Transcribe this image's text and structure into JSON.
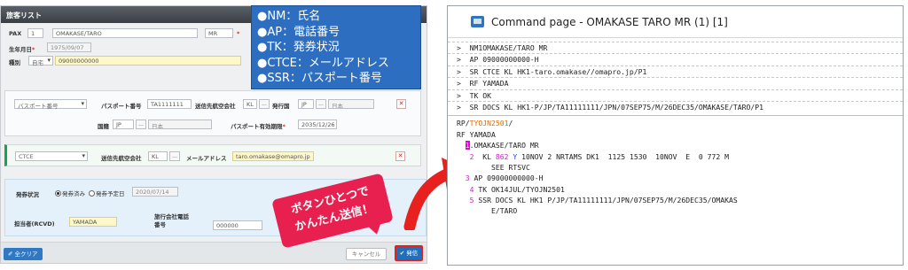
{
  "form": {
    "title": "旅客リスト",
    "pax_label": "PAX",
    "pax_number": "1",
    "pax_name": "OMAKASE/TARO",
    "pax_title": "MR",
    "dob_label": "生年月日",
    "dob_value": "1975/09/07",
    "type_label": "種別",
    "type_value": "自宅",
    "phone_value": "09000000000",
    "passport": {
      "doc_type": "パスポート番号",
      "number_label": "パスポート番号",
      "number_value": "TA1111111",
      "airline_label": "送信先航空会社",
      "airline_value": "KL",
      "issuer_label": "発行国",
      "issuer_code": "JP",
      "issuer_name": "日本",
      "nationality_label": "国籍",
      "nationality_code": "JP",
      "nationality_name": "日本",
      "expiry_label": "パスポート有効期限",
      "expiry_value": "2035/12/26"
    },
    "email": {
      "type": "CTCE",
      "airline_label": "送信先航空会社",
      "airline_value": "KL",
      "address_label": "メールアドレス",
      "address_value": "taro.omakase@omapro.jp"
    },
    "ticketing": {
      "status_label": "発券状況",
      "option_issued": "発券済み",
      "option_planned": "発券予定日",
      "date_value": "2020/07/14",
      "rep_label": "担当者(RCVD)",
      "rep_value": "YAMADA",
      "agency_phone_label": "旅行会社電話番号",
      "agency_phone_value": "000000"
    },
    "buttons": {
      "clear_all": "全クリア",
      "cancel": "キャンセル",
      "send": "発信",
      "dots": "..."
    }
  },
  "legend": {
    "items": [
      "●NM：氏名",
      "●AP：電話番号",
      "●TK：発券状況",
      "●CTCE：メールアドレス",
      "●SSR：パスポート番号"
    ]
  },
  "callout": {
    "line1": "ボタンひとつで",
    "line2": "かんたん送信！"
  },
  "command_page": {
    "title": "Command page - OMAKASE TARO MR (1) [1]",
    "input_lines": [
      ">  NM1OMAKASE/TARO MR",
      ">  AP 09000000000-H",
      ">  SR CTCE KL HK1-taro.omakase//omapro.jp/P1",
      ">  RF YAMADA",
      ">  TK OK",
      ">  SR DOCS KL HK1-P/JP/TA11111111/JPN/07SEP75/M/26DEC35/OMAKASE/TARO/P1"
    ],
    "rp_prefix": "RP/",
    "rp_code": "TYOJN2501",
    "rp_suffix": "/",
    "rf_line": "RF YAMADA",
    "pnr": {
      "n1": "1",
      "line1": ".OMAKASE/TARO MR",
      "n2": "2",
      "seg_a": "  KL ",
      "seg_flight": "862",
      "seg_b": " ",
      "seg_class": "Y",
      "seg_c": " 10NOV 2 NRTAMS DK1  1125 1530  10NOV  E  0 772 M",
      "see": "   SEE RTSVC",
      "n3": "3",
      "line3": " AP 09000000000-H",
      "n4": "4",
      "line4": " TK OK14JUL/TYOJN2501",
      "n5": "5",
      "line5": " SSR DOCS KL HK1 P/JP/TA11111111/JPN/07SEP75/M/26DEC35/OMAKAS",
      "line5b": "     E/TARO"
    }
  },
  "colors": {
    "legend_bg": "#2d6ec0",
    "callout_bg": "#e8204f",
    "arrow": "#e8201e",
    "send_button": "#1f6fbf",
    "pnr_number": "#d020c8"
  }
}
